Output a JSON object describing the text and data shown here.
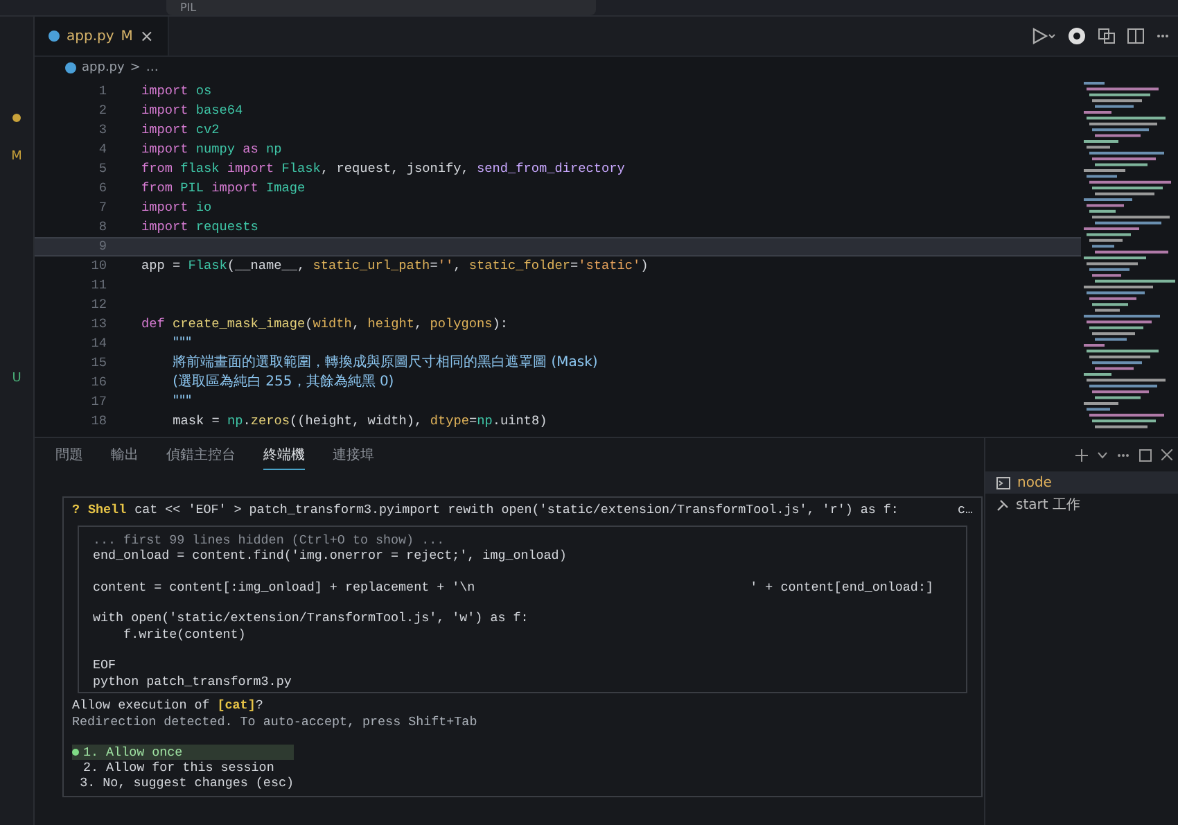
{
  "title_bar": {
    "search": "PIL"
  },
  "activity": [
    {
      "kind": "dot"
    },
    {
      "kind": "letter",
      "text": "M"
    },
    {
      "kind": "letter",
      "text": "U"
    }
  ],
  "editor_tab": {
    "name": "app.py",
    "badge": "M",
    "close": "×",
    "selected": true
  },
  "breadcrumb": {
    "file": "app.py",
    "separator": ">",
    "rest": "…"
  },
  "code_lines": [
    {
      "number": "1",
      "current": false,
      "tokens": [
        {
          "kind": "kw",
          "text": "import "
        },
        {
          "kind": "mod",
          "text": "os"
        }
      ]
    },
    {
      "number": "2",
      "current": false,
      "tokens": [
        {
          "kind": "kw",
          "text": "import "
        },
        {
          "kind": "mod",
          "text": "base64"
        }
      ]
    },
    {
      "number": "3",
      "current": false,
      "tokens": [
        {
          "kind": "kw",
          "text": "import "
        },
        {
          "kind": "mod",
          "text": "cv2"
        }
      ]
    },
    {
      "number": "4",
      "current": false,
      "tokens": [
        {
          "kind": "kw",
          "text": "import "
        },
        {
          "kind": "mod",
          "text": "numpy "
        },
        {
          "kind": "kw",
          "text": "as "
        },
        {
          "kind": "mod",
          "text": "np"
        }
      ]
    },
    {
      "number": "5",
      "current": false,
      "tokens": [
        {
          "kind": "kw",
          "text": "from "
        },
        {
          "kind": "mod",
          "text": "flask "
        },
        {
          "kind": "kw",
          "text": "import "
        },
        {
          "kind": "mod",
          "text": "Flask"
        },
        {
          "kind": "plain",
          "text": ", request, jsonify, "
        },
        {
          "kind": "name",
          "text": "send_from_directory"
        }
      ]
    },
    {
      "number": "6",
      "current": false,
      "tokens": [
        {
          "kind": "kw",
          "text": "from "
        },
        {
          "kind": "mod",
          "text": "PIL "
        },
        {
          "kind": "kw",
          "text": "import "
        },
        {
          "kind": "mod",
          "text": "Image"
        }
      ]
    },
    {
      "number": "7",
      "current": false,
      "tokens": [
        {
          "kind": "kw",
          "text": "import "
        },
        {
          "kind": "mod",
          "text": "io"
        }
      ]
    },
    {
      "number": "8",
      "current": false,
      "tokens": [
        {
          "kind": "kw",
          "text": "import "
        },
        {
          "kind": "mod",
          "text": "requests"
        }
      ]
    },
    {
      "number": "9",
      "current": true
    },
    {
      "number": "10",
      "current": false,
      "tokens": [
        {
          "kind": "plain",
          "text": "app = "
        },
        {
          "kind": "mod",
          "text": "Flask"
        },
        {
          "kind": "plain",
          "text": "(__name__, "
        },
        {
          "kind": "param",
          "text": "static_url_path"
        },
        {
          "kind": "plain",
          "text": "="
        },
        {
          "kind": "str",
          "text": "''"
        },
        {
          "kind": "plain",
          "text": ", "
        },
        {
          "kind": "param",
          "text": "static_folder"
        },
        {
          "kind": "plain",
          "text": "="
        },
        {
          "kind": "str",
          "text": "'static'"
        },
        {
          "kind": "plain",
          "text": ")"
        }
      ]
    },
    {
      "number": "11",
      "current": false
    },
    {
      "number": "12",
      "current": false
    },
    {
      "number": "13",
      "current": false,
      "tokens": [
        {
          "kind": "kw",
          "text": "def "
        },
        {
          "kind": "func",
          "text": "create_mask_image"
        },
        {
          "kind": "plain",
          "text": "("
        },
        {
          "kind": "param",
          "text": "width"
        },
        {
          "kind": "plain",
          "text": ", "
        },
        {
          "kind": "param",
          "text": "height"
        },
        {
          "kind": "plain",
          "text": ", "
        },
        {
          "kind": "param",
          "text": "polygons"
        },
        {
          "kind": "plain",
          "text": "):"
        }
      ]
    },
    {
      "number": "14",
      "current": false,
      "indent": true,
      "tokens": [
        {
          "kind": "doc",
          "text": "\"\"\""
        }
      ]
    },
    {
      "number": "15",
      "current": false,
      "indent": true,
      "tokens": [
        {
          "kind": "doc",
          "text": "將前端畫面的選取範圍，轉換成與原圖尺寸相同的黑白遮罩圖 (Mask)"
        }
      ]
    },
    {
      "number": "16",
      "current": false,
      "indent": true,
      "tokens": [
        {
          "kind": "doc",
          "text": "(選取區為純白 255，其餘為純黑 0)"
        }
      ]
    },
    {
      "number": "17",
      "current": false,
      "indent": true,
      "tokens": [
        {
          "kind": "doc",
          "text": "\"\"\""
        }
      ]
    },
    {
      "number": "18",
      "current": false,
      "indent": true,
      "tokens": [
        {
          "kind": "plain",
          "text": "mask = "
        },
        {
          "kind": "mod",
          "text": "np"
        },
        {
          "kind": "plain",
          "text": "."
        },
        {
          "kind": "func",
          "text": "zeros"
        },
        {
          "kind": "plain",
          "text": "((height, width), "
        },
        {
          "kind": "param",
          "text": "dtype"
        },
        {
          "kind": "plain",
          "text": "="
        },
        {
          "kind": "mod",
          "text": "np"
        },
        {
          "kind": "plain",
          "text": ".uint8)"
        }
      ]
    }
  ],
  "panel_tabs": [
    {
      "label": "問題",
      "selected": false
    },
    {
      "label": "輸出",
      "selected": false
    },
    {
      "label": "偵錯主控台",
      "selected": false
    },
    {
      "label": "終端機",
      "selected": true
    },
    {
      "label": "連接埠",
      "selected": false
    }
  ],
  "prompt": {
    "header": "Shell",
    "mark": "?",
    "command": "cat << 'EOF' > patch_transform3.pyimport rewith open('static/extension/TransformTool.js', 'r') as f:",
    "more": "c…",
    "lines": [
      {
        "kind": "hint",
        "text": "... first 99 lines hidden (Ctrl+O to show) ..."
      },
      {
        "kind": "code",
        "text": "end_onload = content.find('img.onerror = reject;', img_onload)"
      },
      {
        "kind": "blank"
      },
      {
        "kind": "code",
        "text": "content = content[:img_onload] + replacement + '\\n                                    ' + content[end_onload:]"
      },
      {
        "kind": "blank"
      },
      {
        "kind": "code",
        "text": "with open('static/extension/TransformTool.js', 'w') as f:"
      },
      {
        "kind": "code",
        "text": "    f.write(content)"
      },
      {
        "kind": "blank"
      },
      {
        "kind": "code",
        "text": "EOF"
      },
      {
        "kind": "code",
        "text": "python patch_transform3.py"
      }
    ],
    "question": "Allow execution of **[cat]**?",
    "note": "Redirection detected. To auto-accept, press Shift+Tab",
    "options": [
      {
        "text": "1. Allow once",
        "selected": true
      },
      {
        "text": "2. Allow for this session",
        "selected": false
      },
      {
        "text": "3. No, suggest changes (esc)",
        "selected": false
      }
    ]
  },
  "terminals": [
    {
      "kind": "terminal",
      "label": "node",
      "selected": true
    },
    {
      "kind": "task",
      "label": "start 工作",
      "selected": false
    }
  ]
}
